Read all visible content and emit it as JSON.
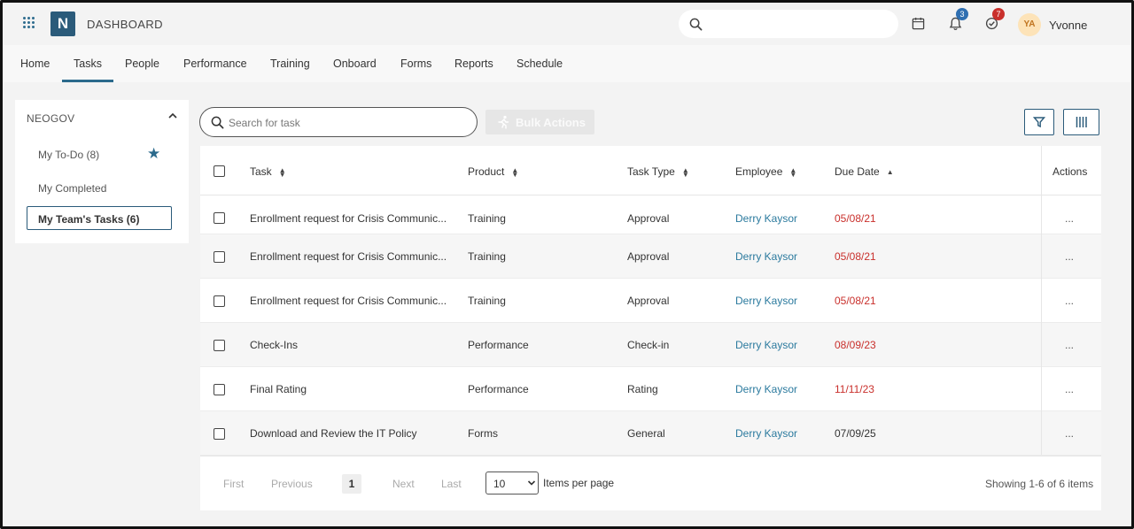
{
  "header": {
    "brand": "DASHBOARD",
    "logo_letter": "N",
    "search_placeholder": "",
    "notifications_count": "3",
    "tasks_count": "7",
    "avatar_initials": "YA",
    "username": "Yvonne"
  },
  "nav": {
    "items": [
      "Home",
      "Tasks",
      "People",
      "Performance",
      "Training",
      "Onboard",
      "Forms",
      "Reports",
      "Schedule"
    ],
    "active": "Tasks"
  },
  "sidebar": {
    "title": "NEOGOV",
    "items": [
      {
        "label": "My To-Do (8)",
        "starred": true
      },
      {
        "label": "My Completed"
      },
      {
        "label": "My Team's Tasks (6)",
        "active": true
      }
    ]
  },
  "toolbar": {
    "search_placeholder": "Search for task",
    "bulk_actions_label": "Bulk Actions"
  },
  "table": {
    "columns": [
      "Task",
      "Product",
      "Task Type",
      "Employee",
      "Due Date",
      "Actions"
    ],
    "rows": [
      {
        "task": "Enrollment request for Crisis Communic...",
        "product": "Training",
        "type": "Approval",
        "employee": "Derry Kaysor",
        "due": "05/08/21",
        "overdue": true,
        "actions": "..."
      },
      {
        "task": "Enrollment request for Crisis Communic...",
        "product": "Training",
        "type": "Approval",
        "employee": "Derry Kaysor",
        "due": "05/08/21",
        "overdue": true,
        "actions": "..."
      },
      {
        "task": "Enrollment request for Crisis Communic...",
        "product": "Training",
        "type": "Approval",
        "employee": "Derry Kaysor",
        "due": "05/08/21",
        "overdue": true,
        "actions": "..."
      },
      {
        "task": "Check-Ins",
        "product": "Performance",
        "type": "Check-in",
        "employee": "Derry Kaysor",
        "due": "08/09/23",
        "overdue": true,
        "actions": "..."
      },
      {
        "task": "Final Rating",
        "product": "Performance",
        "type": "Rating",
        "employee": "Derry Kaysor",
        "due": "11/11/23",
        "overdue": true,
        "actions": "..."
      },
      {
        "task": "Download and Review the IT Policy",
        "product": "Forms",
        "type": "General",
        "employee": "Derry Kaysor",
        "due": "07/09/25",
        "overdue": false,
        "actions": "..."
      }
    ]
  },
  "pagination": {
    "first": "First",
    "previous": "Previous",
    "current_page": "1",
    "next": "Next",
    "last": "Last",
    "per_page_value": "10",
    "per_page_label": "Items per page",
    "showing": "Showing 1-6 of 6 items"
  },
  "colors": {
    "brand_dark": "#2b5b7a",
    "link": "#2b7a9e",
    "overdue": "#c9302c",
    "badge_blue": "#2f6fb1",
    "badge_red": "#c9302c"
  }
}
